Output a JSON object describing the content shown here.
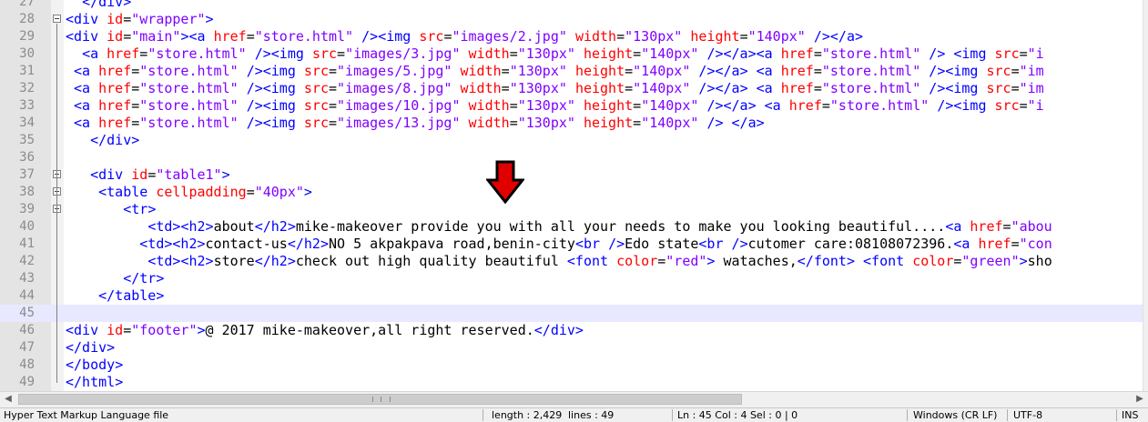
{
  "editor": {
    "lines": [
      {
        "no": "27",
        "text": "  </div>"
      },
      {
        "no": "28",
        "text": "<div id=\"wrapper\">"
      },
      {
        "no": "29",
        "text": "<div id=\"main\"><a href=\"store.html\" /><img src=\"images/2.jpg\" width=\"130px\" height=\"140px\" /></a>"
      },
      {
        "no": "30",
        "text": "  <a href=\"store.html\" /><img src=\"images/3.jpg\" width=\"130px\" height=\"140px\" /></a><a href=\"store.html\" /> <img src=\"i"
      },
      {
        "no": "31",
        "text": " <a href=\"store.html\" /><img src=\"images/5.jpg\" width=\"130px\" height=\"140px\" /></a> <a href=\"store.html\" /><img src=\"im"
      },
      {
        "no": "32",
        "text": " <a href=\"store.html\" /><img src=\"images/8.jpg\" width=\"130px\" height=\"140px\" /></a> <a href=\"store.html\" /><img src=\"im"
      },
      {
        "no": "33",
        "text": " <a href=\"store.html\" /><img src=\"images/10.jpg\" width=\"130px\" height=\"140px\" /></a> <a href=\"store.html\" /><img src=\"i"
      },
      {
        "no": "34",
        "text": " <a href=\"store.html\" /><img src=\"images/13.jpg\" width=\"130px\" height=\"140px\" /> </a>"
      },
      {
        "no": "35",
        "text": "   </div>"
      },
      {
        "no": "36",
        "text": ""
      },
      {
        "no": "37",
        "text": "   <div id=\"table1\">"
      },
      {
        "no": "38",
        "text": "    <table cellpadding=\"40px\">"
      },
      {
        "no": "39",
        "text": "       <tr>"
      },
      {
        "no": "40",
        "text": "          <td><h2>about</h2>mike-makeover provide you with all your needs to make you looking beautiful....<a href=\"abou"
      },
      {
        "no": "41",
        "text": "         <td><h2>contact-us</h2>NO 5 akpakpava road,benin-city<br />Edo state<br />cutomer care:08108072396.<a href=\"con"
      },
      {
        "no": "42",
        "text": "          <td><h2>store</h2>check out high quality beautiful <font color=\"red\"> wataches,</font> <font color=\"green\">sho"
      },
      {
        "no": "43",
        "text": "       </tr>"
      },
      {
        "no": "44",
        "text": "    </table>"
      },
      {
        "no": "45",
        "text": ""
      },
      {
        "no": "46",
        "text": "<div id=\"footer\">@ 2017 mike-makeover,all right reserved.</div>"
      },
      {
        "no": "47",
        "text": "</div>"
      },
      {
        "no": "48",
        "text": "</body>"
      },
      {
        "no": "49",
        "text": "</html>"
      }
    ],
    "current_line": "45"
  },
  "annotation": {
    "icon": "red-down-arrow-icon",
    "color": "#e00000"
  },
  "colors": {
    "tag": "#0000ff",
    "attribute": "#ff0000",
    "value": "#8000ff",
    "text": "#000000",
    "current_line": "#e8e8ff"
  },
  "statusbar": {
    "file_type": "Hyper Text Markup Language file",
    "length": "length : 2,429",
    "lines": "lines : 49",
    "position": "Ln : 45    Col : 4    Sel : 0 | 0",
    "eol": "Windows (CR LF)",
    "encoding": "UTF-8",
    "mode": "INS"
  }
}
